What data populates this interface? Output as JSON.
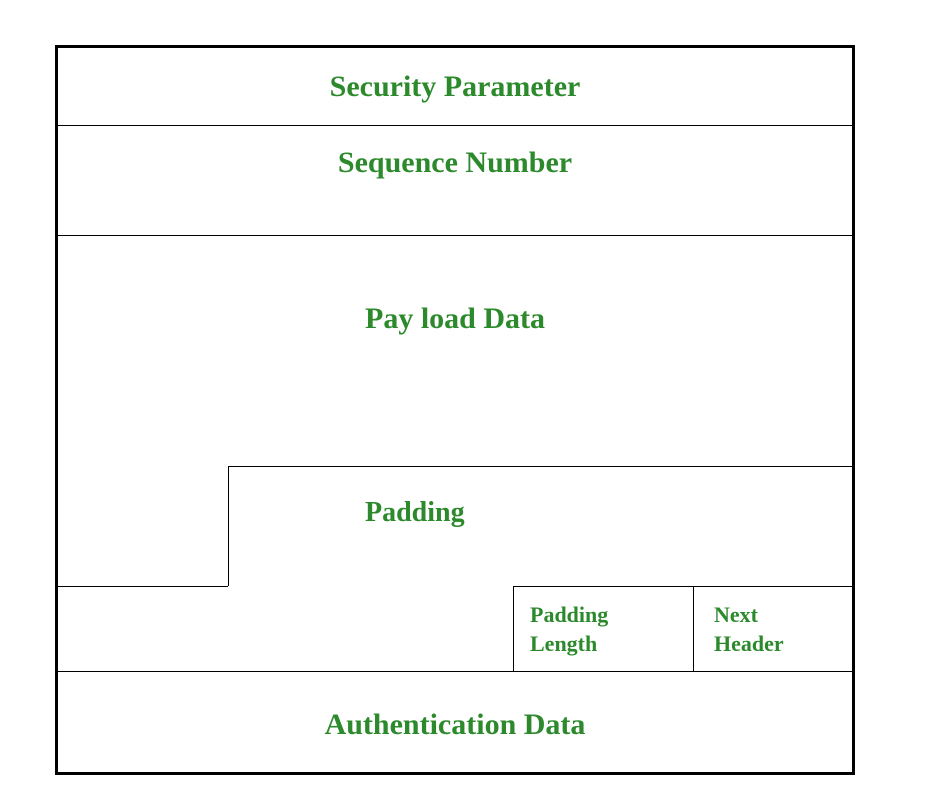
{
  "diagram": {
    "security_parameter": "Security Parameter",
    "sequence_number": "Sequence Number",
    "payload_data": "Pay load Data",
    "padding": "Padding",
    "padding_length_l1": "Padding",
    "padding_length_l2": "Length",
    "next_header_l1": "Next",
    "next_header_l2": "Header",
    "authentication_data": "Authentication Data"
  }
}
